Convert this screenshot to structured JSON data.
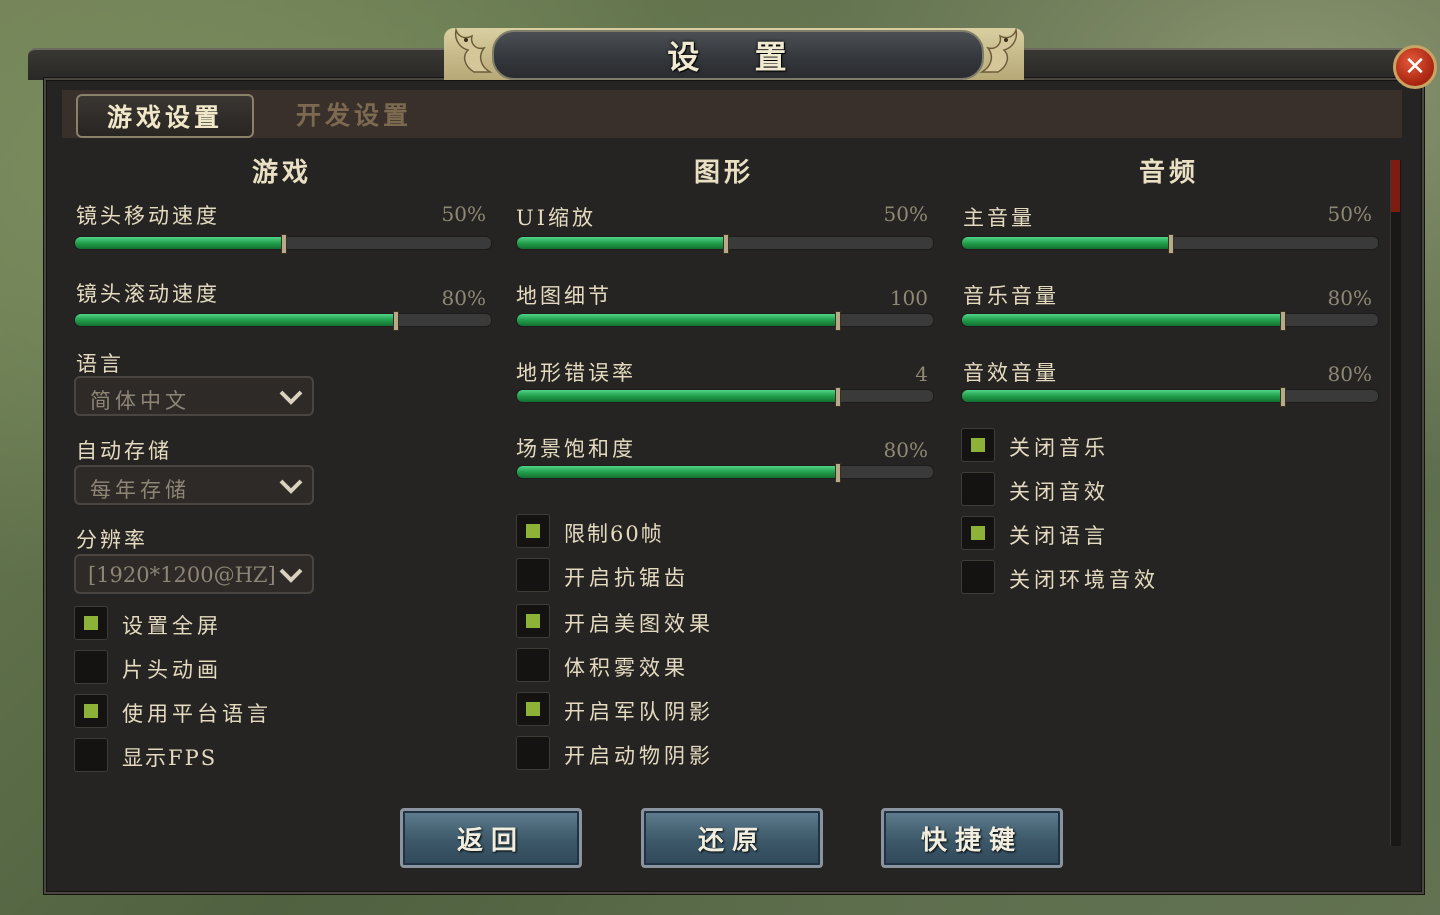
{
  "window": {
    "title": "设 置",
    "close_label": "✕"
  },
  "tabs": [
    {
      "label": "游戏设置",
      "active": true
    },
    {
      "label": "开发设置",
      "active": false
    }
  ],
  "columns": {
    "game": {
      "title": "游戏",
      "sliders": [
        {
          "label": "镜头移动速度",
          "value": "50%",
          "level": 0.5
        },
        {
          "label": "镜头滚动速度",
          "value": "80%",
          "level": 0.77
        }
      ],
      "dropdowns": [
        {
          "label": "语言",
          "value": "简体中文"
        },
        {
          "label": "自动存储",
          "value": "每年存储"
        },
        {
          "label": "分辨率",
          "value": "[1920*1200@HZ]"
        }
      ],
      "checks": [
        {
          "label": "设置全屏",
          "checked": true
        },
        {
          "label": "片头动画",
          "checked": false
        },
        {
          "label": "使用平台语言",
          "checked": true
        },
        {
          "label": "显示FPS",
          "checked": false
        }
      ]
    },
    "graphics": {
      "title": "图形",
      "sliders": [
        {
          "label": "UI缩放",
          "value": "50%",
          "level": 0.5
        },
        {
          "label": "地图细节",
          "value": "100",
          "level": 0.77
        },
        {
          "label": "地形错误率",
          "value": "4",
          "level": 0.77
        },
        {
          "label": "场景饱和度",
          "value": "80%",
          "level": 0.77
        }
      ],
      "checks": [
        {
          "label": "限制60帧",
          "checked": true
        },
        {
          "label": "开启抗锯齿",
          "checked": false
        },
        {
          "label": "开启美图效果",
          "checked": true
        },
        {
          "label": "体积雾效果",
          "checked": false
        },
        {
          "label": "开启军队阴影",
          "checked": true
        },
        {
          "label": "开启动物阴影",
          "checked": false
        }
      ]
    },
    "audio": {
      "title": "音频",
      "sliders": [
        {
          "label": "主音量",
          "value": "50%",
          "level": 0.5
        },
        {
          "label": "音乐音量",
          "value": "80%",
          "level": 0.77
        },
        {
          "label": "音效音量",
          "value": "80%",
          "level": 0.77
        }
      ],
      "checks": [
        {
          "label": "关闭音乐",
          "checked": true
        },
        {
          "label": "关闭音效",
          "checked": false
        },
        {
          "label": "关闭语言",
          "checked": true
        },
        {
          "label": "关闭环境音效",
          "checked": false
        }
      ]
    }
  },
  "buttons": {
    "back": "返回",
    "restore": "还原",
    "shortcuts": "快捷键"
  },
  "colors": {
    "accent_green": "#2fb35c",
    "check_on": "#8db238",
    "close_red": "#c0341a",
    "panel_bg": "#262422"
  }
}
